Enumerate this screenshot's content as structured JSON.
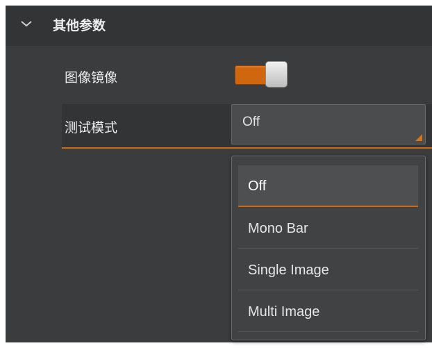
{
  "section": {
    "title": "其他参数",
    "icon": "chevron-down-icon"
  },
  "params": {
    "mirror_label": "图像镜像",
    "mirror_enabled": true,
    "test_mode_label": "测试模式",
    "test_mode_value": "Off"
  },
  "dropdown": {
    "options": [
      "Off",
      "Mono Bar",
      "Single Image",
      "Multi Image"
    ],
    "selected": "Off"
  },
  "colors": {
    "accent": "#d0660e",
    "panel": "#3b3c3e"
  }
}
